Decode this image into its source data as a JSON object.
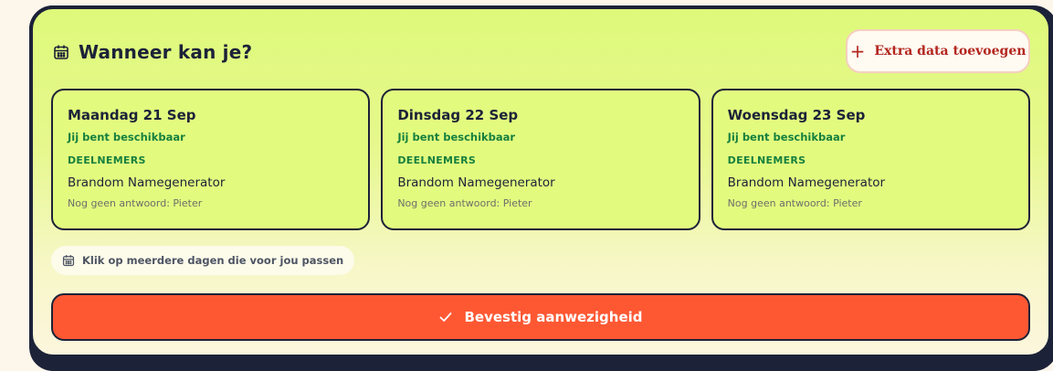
{
  "header": {
    "title": "Wanneer kan je?",
    "icon": "calendar-icon"
  },
  "add_button": {
    "label": "Extra data toevoegen",
    "icon": "plus-icon",
    "color": "#b3261e"
  },
  "days": [
    {
      "name": "Maandag 21 Sep",
      "status": "Jij bent beschikbaar",
      "participants_label": "DEELNEMERS",
      "participant": "Brandom Namegenerator",
      "no_answer": "Nog geen antwoord: Pieter"
    },
    {
      "name": "Dinsdag 22 Sep",
      "status": "Jij bent beschikbaar",
      "participants_label": "DEELNEMERS",
      "participant": "Brandom Namegenerator",
      "no_answer": "Nog geen antwoord: Pieter"
    },
    {
      "name": "Woensdag 23 Sep",
      "status": "Jij bent beschikbaar",
      "participants_label": "DEELNEMERS",
      "participant": "Brandom Namegenerator",
      "no_answer": "Nog geen antwoord: Pieter"
    }
  ],
  "hint": {
    "text": "Klik op meerdere dagen die voor jou passen",
    "icon": "calendar-icon"
  },
  "confirm_button": {
    "label": "Bevestig aanwezigheid",
    "icon": "check-icon",
    "color": "#fe5833"
  },
  "colors": {
    "accent_green": "#17803e",
    "dark": "#1c2238",
    "day_card": "#e2fb7f"
  }
}
